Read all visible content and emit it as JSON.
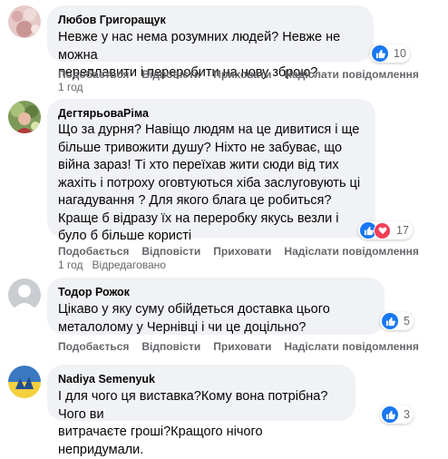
{
  "colors": {
    "like": "#1877f2",
    "love": "#f33e58",
    "bubble": "#f0f2f5",
    "meta": "#65676b"
  },
  "actions": {
    "like": "Подобається",
    "reply": "Відповісти",
    "hide": "Приховати",
    "send": "Надіслати повідомлення"
  },
  "comments": [
    {
      "author": "Любов Григоращук",
      "lines": [
        "Невже у нас нема розумних людей? Невже не можна",
        "переплавити і переробити на нову зброю?"
      ],
      "time": "1 год",
      "edited": "",
      "reactions": {
        "icons": [
          "like-icon"
        ],
        "count": "10"
      }
    },
    {
      "author": "ДегтярьоваРіма",
      "lines": [
        "Що за дурня? Навіщо людям на це дивитися і ще",
        "більше тривожити душу? Ніхто не забуває, що",
        "війна зараз! Ті хто переїхав жити сюди від тих",
        "жахіть і потроху оговтуються хіба заслуговують ці",
        "нагадування ? Для якого блага це робиться?",
        "Краще б відразу їх на переробку якусь везли і",
        "було б більше користі"
      ],
      "time": "1 год",
      "edited": "Відредаговано",
      "reactions": {
        "icons": [
          "like-icon",
          "love-icon"
        ],
        "count": "17"
      }
    },
    {
      "author": "Тодор Рожок",
      "lines": [
        "Цікаво у яку суму обійдеться доставка цього",
        "металолому у Чернівці і чи це доцільно?"
      ],
      "time": "",
      "edited": "",
      "reactions": {
        "icons": [
          "like-icon"
        ],
        "count": "5"
      }
    },
    {
      "author": "Nadiya Semenyuk",
      "lines": [
        "І для чого ця виставка?Кому вона потрібна?Чого ви",
        "витрачаєте гроші?Кращого нічого непридумали."
      ],
      "time": "",
      "edited": "",
      "reactions": {
        "icons": [
          "like-icon"
        ],
        "count": "3"
      }
    }
  ]
}
